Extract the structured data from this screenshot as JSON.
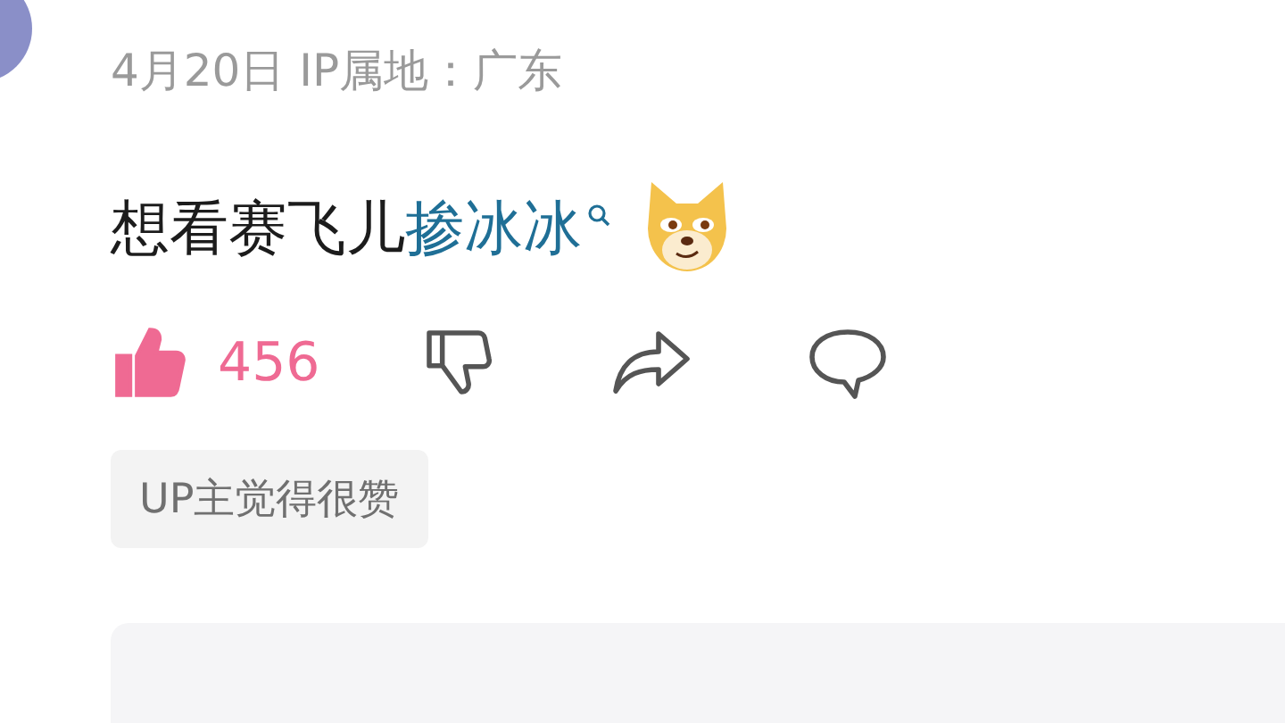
{
  "comment": {
    "meta": "4月20日 IP属地：广东",
    "text": "想看赛飞儿",
    "link": "掺冰冰",
    "actions": {
      "liked": true,
      "like_count": "456"
    },
    "tag": "UP主觉得很赞"
  }
}
